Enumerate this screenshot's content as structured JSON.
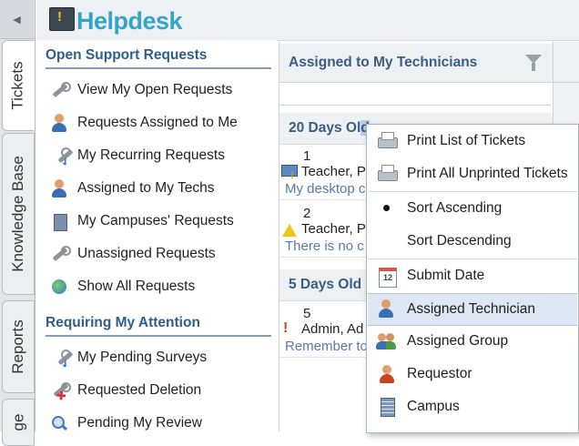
{
  "app": {
    "title": "Helpdesk"
  },
  "tabs": [
    {
      "label": "Tickets"
    },
    {
      "label": "Knowledge Base"
    },
    {
      "label": "Reports"
    },
    {
      "label": "ge"
    }
  ],
  "sidebar": {
    "open_title": "Open Support Requests",
    "open_items": [
      {
        "label": "View My Open Requests",
        "icon": "wrench-icon"
      },
      {
        "label": "Requests Assigned to Me",
        "icon": "user-wrench-icon"
      },
      {
        "label": "My Recurring Requests",
        "icon": "recurring-wrench-icon"
      },
      {
        "label": "Assigned to My Techs",
        "icon": "techs-icon"
      },
      {
        "label": "My Campuses' Requests",
        "icon": "campus-icon"
      },
      {
        "label": "Unassigned Requests",
        "icon": "wrench-icon"
      },
      {
        "label": "Show All Requests",
        "icon": "globe-icon"
      }
    ],
    "attention_title": "Requiring My Attention",
    "attention_items": [
      {
        "label": "My Pending Surveys",
        "icon": "survey-icon"
      },
      {
        "label": "Requested Deletion",
        "icon": "delete-request-icon"
      },
      {
        "label": "Pending My Review",
        "icon": "review-icon"
      }
    ]
  },
  "main": {
    "title": "Assigned to My Technicians",
    "group1": {
      "prefix": "20 Days Ol",
      "highlight": "d"
    },
    "group2": {
      "label": "5 Days Old"
    },
    "tickets": [
      {
        "number": "1",
        "who": "Teacher, P",
        "snippet": "My desktop c"
      },
      {
        "number": "2",
        "who": "Teacher, P",
        "snippet": "There is no c"
      },
      {
        "number": "5",
        "who": "Admin, Ad",
        "snippet": "Remember to"
      }
    ]
  },
  "context_menu": {
    "items": [
      {
        "label": "Print List of Tickets",
        "icon": "printer-icon"
      },
      {
        "label": "Print All Unprinted Tickets",
        "icon": "printer-icon"
      },
      {
        "label": "Sort Ascending",
        "icon": "bullet-icon"
      },
      {
        "label": "Sort Descending",
        "icon": ""
      },
      {
        "label": "Submit Date",
        "icon": "calendar-icon"
      },
      {
        "label": "Assigned Technician",
        "icon": "technician-icon"
      },
      {
        "label": "Assigned Group",
        "icon": "group-icon"
      },
      {
        "label": "Requestor",
        "icon": "requestor-icon"
      },
      {
        "label": "Campus",
        "icon": "campus-icon"
      }
    ],
    "selected": "Assigned Technician"
  },
  "colors": {
    "brand": "#38a3c9",
    "section_title": "#2f5e8a",
    "menu_highlight": "#dde6f2"
  }
}
